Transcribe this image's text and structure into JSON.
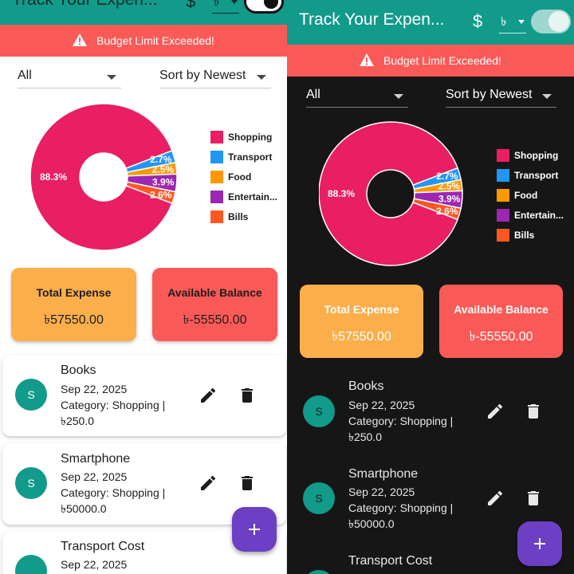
{
  "app": {
    "title": "Track Your Expen...",
    "currency_symbol": "$",
    "currency_selected": "৳"
  },
  "banner": {
    "text": "Budget Limit Exceeded!"
  },
  "filters": {
    "category_selected": "All",
    "sort_selected": "Sort by Newest"
  },
  "chart_data": {
    "type": "pie",
    "donut": true,
    "title": "",
    "slices": [
      {
        "label": "Shopping",
        "value": 88.3,
        "display": "88.3%",
        "color": "#e91e63"
      },
      {
        "label": "Transport",
        "value": 2.7,
        "display": "2.7%",
        "color": "#2196f3"
      },
      {
        "label": "Food",
        "value": 2.5,
        "display": "2.5%",
        "color": "#ff9800"
      },
      {
        "label": "Entertainment",
        "value": 3.9,
        "display": "3.9%",
        "color": "#9c27b0"
      },
      {
        "label": "Bills",
        "value": 2.6,
        "display": "2.6%",
        "color": "#ff5722"
      }
    ],
    "legend_labels": [
      "Shopping",
      "Transport",
      "Food",
      "Entertain...",
      "Bills"
    ],
    "legend_position": "right"
  },
  "summary": {
    "total_expense_label": "Total Expense",
    "total_expense_value": "৳57550.00",
    "available_balance_label": "Available Balance",
    "available_balance_value": "৳-55550.00"
  },
  "expenses": [
    {
      "avatar": "S",
      "name": "Books",
      "date": "Sep 22, 2025",
      "category_line": "Category: Shopping |",
      "amount": "৳250.0"
    },
    {
      "avatar": "S",
      "name": "Smartphone",
      "date": "Sep 22, 2025",
      "category_line": "Category: Shopping |",
      "amount": "৳50000.0"
    },
    {
      "avatar": "",
      "name": "Transport Cost",
      "date": "Sep 22, 2025",
      "category_line": "",
      "amount": ""
    }
  ],
  "colors": {
    "primary": "#129a8b",
    "warning": "#fa5a57",
    "orange": "#fbae4a",
    "fab": "#6c3fc4",
    "dark_bg": "#161616"
  },
  "icons": {
    "edit": "pencil-icon",
    "delete": "trash-icon",
    "warning": "warning-icon",
    "add": "plus-icon"
  }
}
